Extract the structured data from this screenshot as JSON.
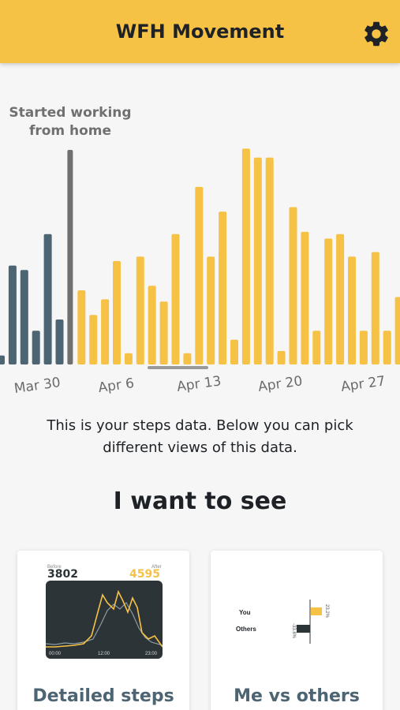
{
  "header": {
    "title": "WFH Movement",
    "settings_icon": "gear-icon"
  },
  "colors": {
    "accent": "#f5c245",
    "before": "#4d6473",
    "divider": "#707070",
    "text_dark": "#1e2226"
  },
  "chart_data": {
    "type": "bar",
    "annotation": "Started working\nfrom home",
    "tick_labels": [
      "Mar 30",
      "Apr 6",
      "Apr 13",
      "Apr 20",
      "Apr 27"
    ],
    "before": [
      4,
      44,
      42,
      15,
      58,
      20
    ],
    "after": [
      33,
      22,
      29,
      46,
      5,
      48,
      35,
      28,
      58,
      5,
      79,
      48,
      68,
      11,
      96,
      92,
      92,
      6,
      70,
      59,
      15,
      56,
      58,
      48,
      15,
      50,
      15,
      30
    ],
    "ylim": [
      0,
      100
    ]
  },
  "intro": {
    "description": "This is your steps data. Below you can pick different views of this data.",
    "heading": "I want to see"
  },
  "cards": {
    "detailed": {
      "title": "Detailed steps",
      "before_label": "Before",
      "before_value": "3802",
      "after_label": "After",
      "after_value": "4595",
      "times": [
        "00:00",
        "12:00",
        "23:00"
      ]
    },
    "compare": {
      "title": "Me vs others",
      "you_label": "You",
      "others_label": "Others",
      "you_value": "23.2%",
      "others_value": "-33.8%"
    }
  }
}
